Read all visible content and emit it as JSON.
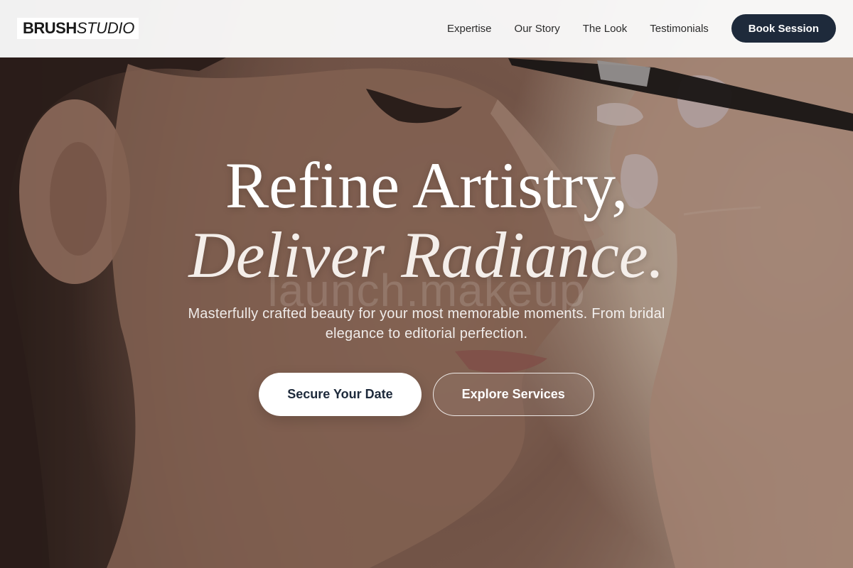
{
  "brand": {
    "name_strong": "BRUSH",
    "name_light": "STUDIO"
  },
  "nav": {
    "links": [
      "Expertise",
      "Our Story",
      "The Look",
      "Testimonials"
    ],
    "cta_label": "Book Session"
  },
  "hero": {
    "headline_line1": "Refine Artistry,",
    "headline_line2": "Deliver Radiance.",
    "watermark": "launch.makeup",
    "subtext": "Masterfully crafted beauty for your most memorable moments. From bridal elegance to editorial perfection.",
    "primary_cta": "Secure Your Date",
    "secondary_cta": "Explore Services",
    "image_icon": "makeup-portrait-photo"
  },
  "colors": {
    "accent": "#1e2a3b",
    "nav_background": "#fafafa",
    "headline": "#ffffff"
  }
}
